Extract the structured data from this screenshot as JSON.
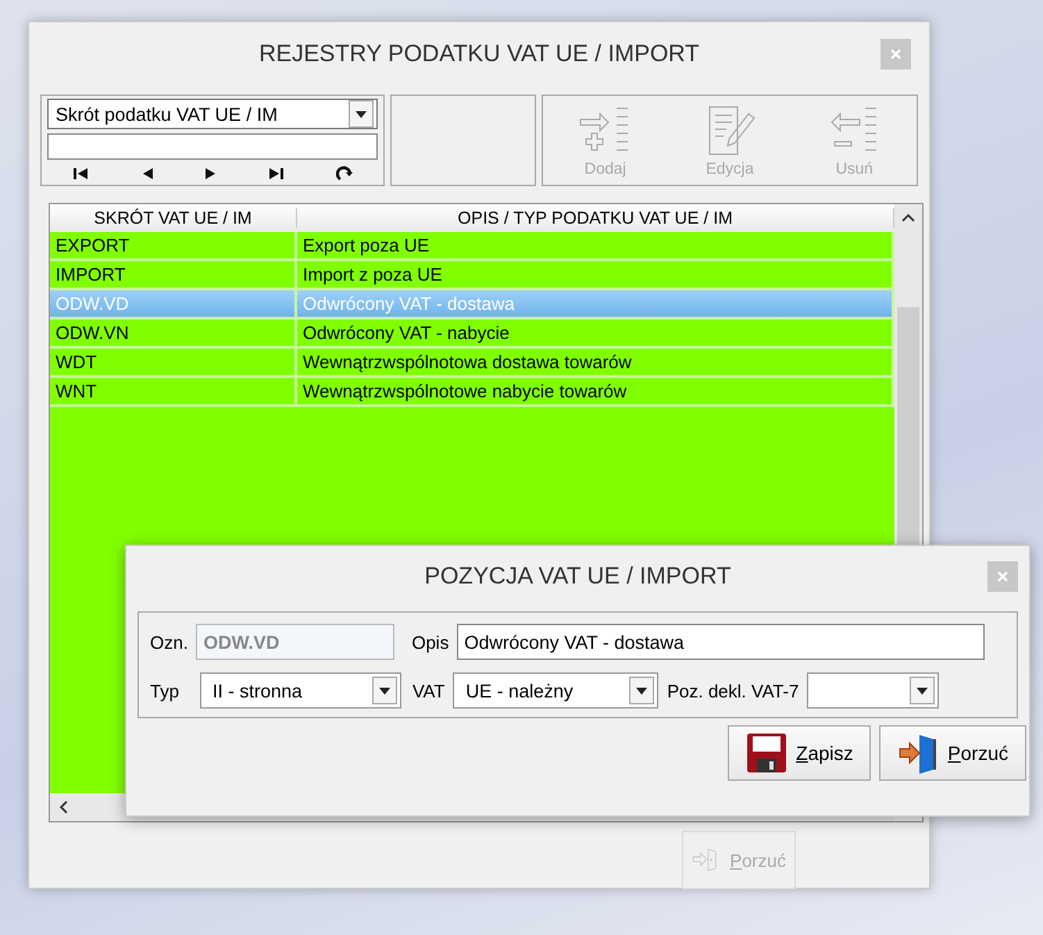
{
  "main_window": {
    "title": "REJESTRY PODATKU VAT UE / IMPORT",
    "filter": {
      "field": "Skrót podatku VAT UE / IM"
    },
    "toolbar": [
      {
        "kind": "add",
        "label": "Dodaj",
        "disabled": true
      },
      {
        "kind": "edit",
        "label": "Edycja",
        "disabled": true
      },
      {
        "kind": "remove",
        "label": "Usuń",
        "disabled": true
      }
    ],
    "grid": {
      "columns": [
        "SKRÓT VAT UE / IM",
        "OPIS / TYP PODATKU VAT UE / IM"
      ],
      "rows": [
        {
          "code": "EXPORT",
          "description": "Export poza UE",
          "selected": false
        },
        {
          "code": "IMPORT",
          "description": "Import z poza UE",
          "selected": false
        },
        {
          "code": "ODW.VD",
          "description": "Odwrócony VAT - dostawa",
          "selected": true
        },
        {
          "code": "ODW.VN",
          "description": "Odwrócony VAT - nabycie",
          "selected": false
        },
        {
          "code": "WDT",
          "description": "Wewnątrzwspólnotowa dostawa towarów",
          "selected": false
        },
        {
          "code": "WNT",
          "description": "Wewnątrzwspólnotowe nabycie towarów",
          "selected": false
        }
      ]
    },
    "bottom_button": {
      "label": "Porzuć",
      "disabled": true
    }
  },
  "dialog": {
    "title": "POZYCJA VAT UE / IMPORT",
    "fields": {
      "ozn": {
        "label": "Ozn.",
        "value": "ODW.VD",
        "disabled": true
      },
      "opis": {
        "label": "Opis",
        "value": "Odwrócony VAT - dostawa"
      },
      "typ": {
        "label": "Typ",
        "value": "II - stronna"
      },
      "vat": {
        "label": "VAT",
        "value": "UE - należny"
      },
      "poz": {
        "label": "Poz. dekl. VAT-7"
      }
    },
    "buttons": [
      {
        "kind": "save",
        "label": "Zapisz"
      },
      {
        "kind": "cancel",
        "label": "Porzuć"
      }
    ]
  }
}
